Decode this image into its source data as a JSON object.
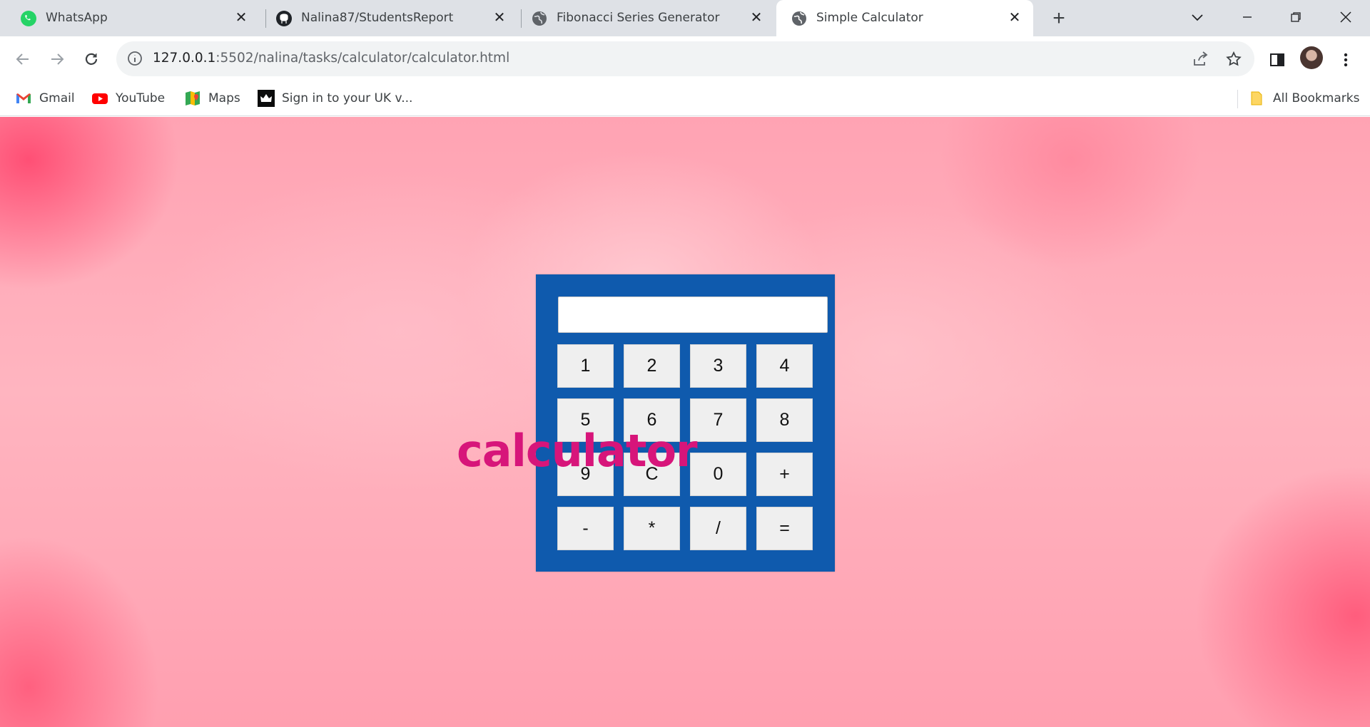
{
  "tabs": [
    {
      "title": "WhatsApp",
      "icon": "whatsapp-icon"
    },
    {
      "title": "Nalina87/StudentsReport",
      "icon": "github-icon"
    },
    {
      "title": "Fibonacci Series Generator",
      "icon": "globe-icon"
    },
    {
      "title": "Simple Calculator",
      "icon": "globe-icon",
      "active": true
    }
  ],
  "address_bar": {
    "host": "127.0.0.1",
    "path": ":5502/nalina/tasks/calculator/calculator.html"
  },
  "bookmarks": [
    {
      "label": "Gmail",
      "icon": "gmail-icon"
    },
    {
      "label": "YouTube",
      "icon": "youtube-icon"
    },
    {
      "label": "Maps",
      "icon": "maps-icon"
    },
    {
      "label": "Sign in to your UK v...",
      "icon": "crown-icon"
    }
  ],
  "all_bookmarks_label": "All Bookmarks",
  "calculator": {
    "display_value": "",
    "keys": [
      "1",
      "2",
      "3",
      "4",
      "5",
      "6",
      "7",
      "8",
      "9",
      "C",
      "0",
      "+",
      "-",
      "*",
      "/",
      "="
    ],
    "overlay_text": "calculator"
  },
  "colors": {
    "calculator_body": "#0f5aad",
    "overlay_text": "#d7157a",
    "page_background": "#ffb5c0"
  }
}
